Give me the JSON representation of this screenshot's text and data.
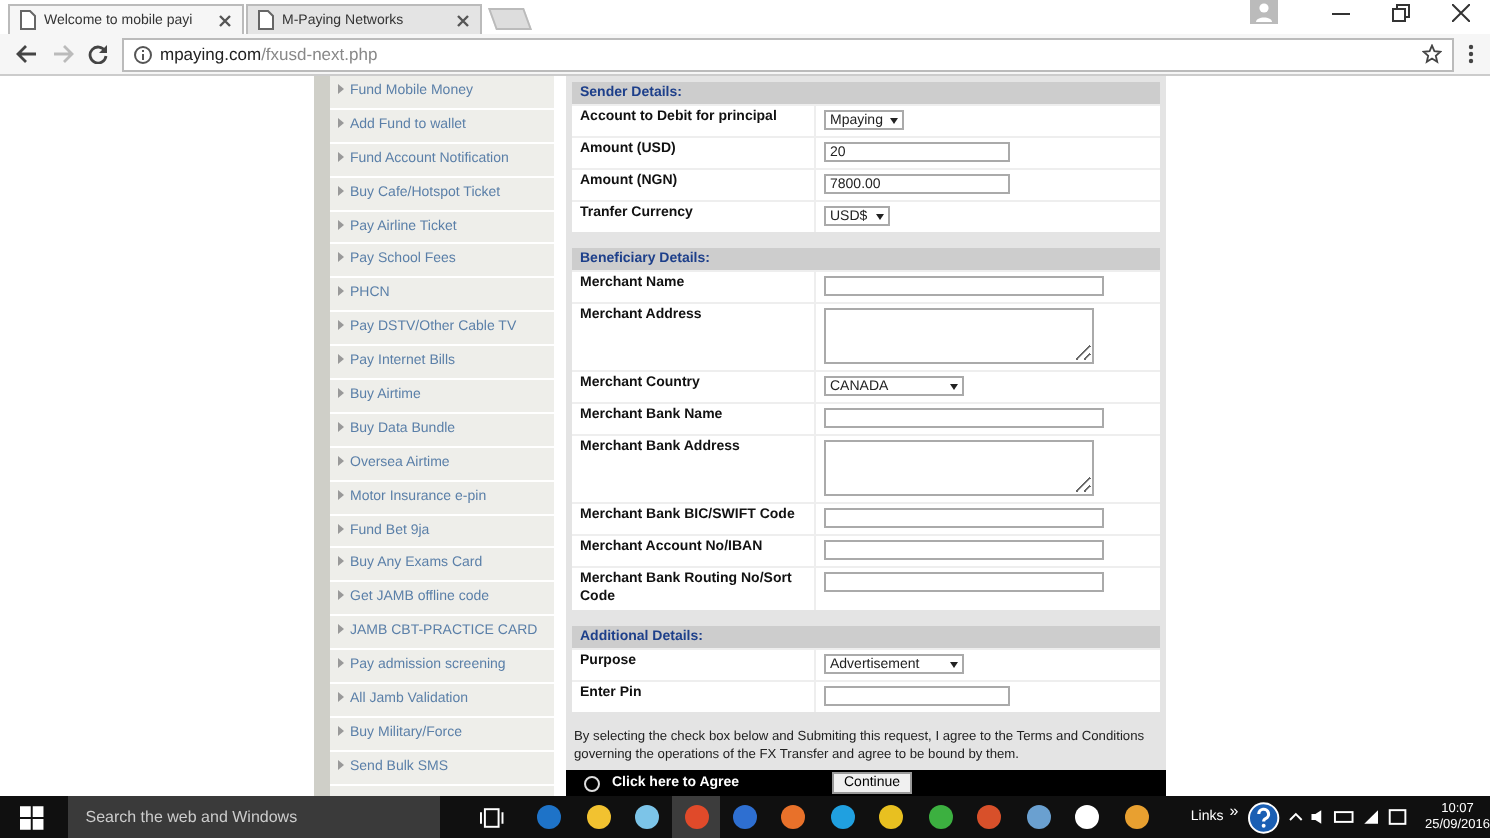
{
  "browser": {
    "tabs": [
      {
        "title": "Welcome to mobile payi",
        "selected": true
      },
      {
        "title": "M-Paying Networks",
        "selected": false
      }
    ],
    "url_host": "mpaying.com",
    "url_path": "/fxusd-next.php"
  },
  "sidebar": {
    "items": [
      "Fund Mobile Money",
      "Add Fund to wallet",
      "Fund Account Notification",
      "Buy Cafe/Hotspot Ticket",
      "Pay Airline Ticket",
      "Pay School Fees",
      "PHCN",
      "Pay DSTV/Other Cable TV",
      "Pay Internet Bills",
      "Buy Airtime",
      "Buy Data Bundle",
      "Oversea Airtime",
      "Motor Insurance e-pin",
      "Fund Bet 9ja",
      "Buy Any Exams Card",
      "Get JAMB offline code",
      "JAMB CBT-PRACTICE CARD",
      "Pay admission screening",
      "All Jamb Validation",
      "Buy Military/Force",
      "Send Bulk SMS"
    ]
  },
  "form": {
    "sections": [
      {
        "title": "Sender Details:",
        "rows": [
          {
            "label": "Account to Debit for principal",
            "kind": "select",
            "value": "Mpaying"
          },
          {
            "label": "Amount (USD)",
            "kind": "input",
            "value": "20"
          },
          {
            "label": "Amount (NGN)",
            "kind": "input",
            "value": "7800.00"
          },
          {
            "label": "Tranfer Currency",
            "kind": "select",
            "value": "USD$"
          }
        ]
      },
      {
        "title": "Beneficiary Details:",
        "rows": [
          {
            "label": "Merchant Name",
            "kind": "input"
          },
          {
            "label": "Merchant Address",
            "kind": "textarea"
          },
          {
            "label": "Merchant Country",
            "kind": "select",
            "value": "CANADA"
          },
          {
            "label": "Merchant Bank Name",
            "kind": "input"
          },
          {
            "label": "Merchant Bank Address",
            "kind": "textarea"
          },
          {
            "label": "Merchant Bank BIC/SWIFT Code",
            "kind": "input"
          },
          {
            "label": "Merchant Account No/IBAN",
            "kind": "input"
          },
          {
            "label": "Merchant Bank Routing No/Sort Code",
            "kind": "input"
          }
        ]
      },
      {
        "title": "Additional Details:",
        "rows": [
          {
            "label": "Purpose",
            "kind": "select",
            "value": "Advertisement"
          },
          {
            "label": "Enter Pin",
            "kind": "input"
          }
        ]
      }
    ],
    "terms": "By selecting the check box below and Submiting this request, I agree to the Terms and Conditions  governing the operations of the FX Transfer and agree to be bound by them.",
    "agree": {
      "label": "Click here to Agree",
      "selected": false
    },
    "submit": "Continue"
  },
  "taskbar": {
    "search_placeholder": "Search the web and Windows",
    "links": "Links",
    "chevron": "»",
    "time": "10:07",
    "date": "25/09/2016"
  }
}
